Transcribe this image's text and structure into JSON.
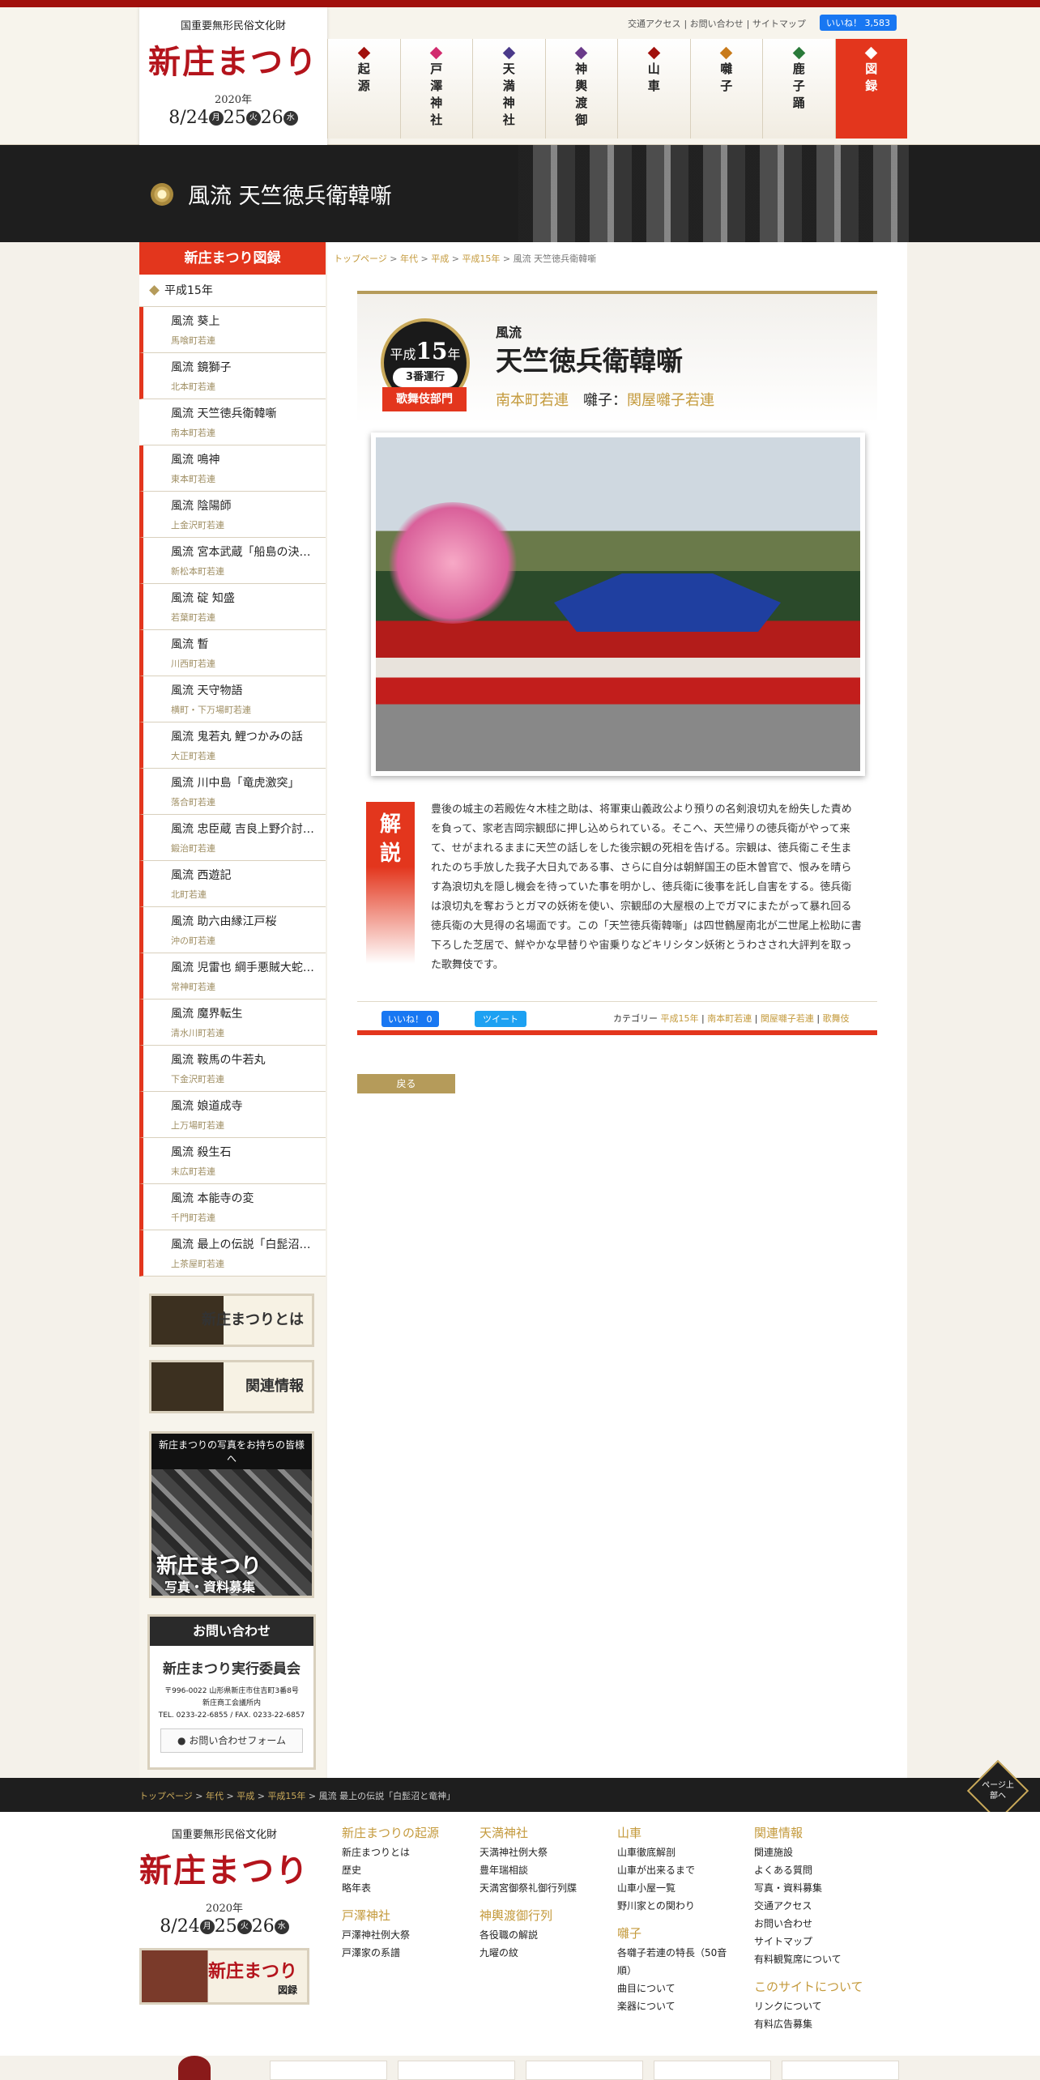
{
  "header": {
    "logo_sub": "国重要無形民俗文化財",
    "logo_main": "新庄まつり",
    "year": "2020年",
    "date_parts": [
      "8/24",
      "月",
      "25",
      "火",
      "26",
      "水"
    ],
    "utility_links": [
      "交通アクセス",
      "お問い合わせ",
      "サイトマップ"
    ],
    "like_label": "いいね！ 3,583"
  },
  "gnav": [
    {
      "label": "起源",
      "color": "#a1100c"
    },
    {
      "label": "戸澤神社",
      "color": "#d12b6e"
    },
    {
      "label": "天満神社",
      "color": "#4a3a8a"
    },
    {
      "label": "神輿渡御",
      "color": "#6a3a8a"
    },
    {
      "label": "山車",
      "color": "#a1100c"
    },
    {
      "label": "囃子",
      "color": "#c87a1a"
    },
    {
      "label": "鹿子踊",
      "color": "#2a7a3a"
    },
    {
      "label": "図録",
      "color": "#ffffff"
    }
  ],
  "band": {
    "title": "風流 天竺徳兵衛韓噺"
  },
  "sidebar": {
    "heading": "新庄まつり図録",
    "year_label": "平成15年",
    "items": [
      {
        "title": "風流 葵上",
        "sub": "馬喰町若連"
      },
      {
        "title": "風流 鏡獅子",
        "sub": "北本町若連"
      },
      {
        "title": "風流 天竺徳兵衛韓噺",
        "sub": "南本町若連"
      },
      {
        "title": "風流 鳴神",
        "sub": "東本町若連"
      },
      {
        "title": "風流 陰陽師",
        "sub": "上金沢町若連"
      },
      {
        "title": "風流 宮本武蔵「船島の決…",
        "sub": "新松本町若連"
      },
      {
        "title": "風流 碇 知盛",
        "sub": "若葉町若連"
      },
      {
        "title": "風流 暫",
        "sub": "川西町若連"
      },
      {
        "title": "風流 天守物語",
        "sub": "横町・下万場町若連"
      },
      {
        "title": "風流 鬼若丸 鯉つかみの話",
        "sub": "大正町若連"
      },
      {
        "title": "風流 川中島「竜虎激突」",
        "sub": "落合町若連"
      },
      {
        "title": "風流 忠臣蔵 吉良上野介討…",
        "sub": "鍛治町若連"
      },
      {
        "title": "風流 西遊記",
        "sub": "北町若連"
      },
      {
        "title": "風流 助六由縁江戸桜",
        "sub": "沖の町若連"
      },
      {
        "title": "風流 児雷也 綱手悪賊大蛇…",
        "sub": "常神町若連"
      },
      {
        "title": "風流 魔界転生",
        "sub": "清水川町若連"
      },
      {
        "title": "風流 鞍馬の牛若丸",
        "sub": "下金沢町若連"
      },
      {
        "title": "風流 娘道成寺",
        "sub": "上万場町若連"
      },
      {
        "title": "風流 殺生石",
        "sub": "末広町若連"
      },
      {
        "title": "風流 本能寺の変",
        "sub": "千門町若連"
      },
      {
        "title": "風流 最上の伝説「白髭沼…",
        "sub": "上茶屋町若連"
      }
    ],
    "banner_about": "新庄まつりとは",
    "banner_related": "関連情報",
    "photo_caption": "新庄まつりの写真をお持ちの皆様へ",
    "photo_title": "新庄まつり",
    "photo_sub": "写真・資料募集",
    "contact": {
      "heading": "お問い合わせ",
      "org": "新庄まつり実行委員会",
      "address": "〒996-0022 山形県新庄市住吉町3番8号",
      "address2": "新庄商工会議所内",
      "tel": "TEL. 0233-22-6855 / FAX. 0233-22-6857",
      "button": "お問い合わせフォーム"
    }
  },
  "breadcrumb": {
    "links": [
      "トップページ",
      "年代",
      "平成",
      "平成15年"
    ],
    "sep": " > ",
    "current": "風流 天竺徳兵衛韓噺"
  },
  "article": {
    "era": "平成",
    "year_num": "15",
    "year_suffix": "年",
    "order": "3番運行",
    "genre": "歌舞伎部門",
    "prefix": "風流",
    "title": "天竺徳兵衛韓噺",
    "group": "南本町若連",
    "hayashi_label": "囃子：",
    "hayashi": "関屋囃子若連",
    "kaisetsu": "解説",
    "description": "豊後の城主の若殿佐々木桂之助は、将軍東山義政公より預りの名剣浪切丸を紛失した責めを負って、家老吉岡宗観邸に押し込められている。そこへ、天竺帰りの徳兵衛がやって来て、せがまれるままに天竺の話しをした後宗観の死相を告げる。宗観は、徳兵衛こそ生まれたのち手放した我子大日丸である事、さらに自分は朝鮮国王の臣木曽官で、恨みを晴らす為浪切丸を隠し機会を待っていた事を明かし、徳兵衛に後事を託し自害をする。徳兵衛は浪切丸を奪おうとガマの妖術を使い、宗観邸の大屋根の上でガマにまたがって暴れ回る徳兵衛の大見得の名場面です。この「天竺徳兵衛韓噺」は四世鶴屋南北が二世尾上松助に書下ろした芝居で、鮮やかな早替りや宙乗りなどキリシタン妖術とうわさされ大評判を取った歌舞伎です。",
    "share_like": "いいね！ 0",
    "share_tweet": "ツイート",
    "category_label": "カテゴリー",
    "categories": [
      "平成15年",
      "南本町若連",
      "関屋囃子若連",
      "歌舞伎"
    ],
    "back": "戻る"
  },
  "footer_crumb": {
    "links": [
      "トップページ",
      "年代",
      "平成",
      "平成15年"
    ],
    "current": "風流 最上の伝説「白髭沼と竜神」"
  },
  "page_top": "ページ上部へ",
  "footer": {
    "banner_title": "新庄まつり",
    "banner_sub": "図録",
    "cols": [
      {
        "groups": [
          {
            "h": "新庄まつりの起源",
            "items": [
              "新庄まつりとは",
              "歴史",
              "略年表"
            ]
          },
          {
            "h": "戸澤神社",
            "items": [
              "戸澤神社例大祭",
              "戸澤家の系譜"
            ]
          }
        ]
      },
      {
        "groups": [
          {
            "h": "天満神社",
            "items": [
              "天満神社例大祭",
              "豊年瑞相談",
              "天満宮御祭礼御行列牒"
            ]
          },
          {
            "h": "神輿渡御行列",
            "items": [
              "各役職の解説",
              "九曜の紋"
            ]
          }
        ]
      },
      {
        "groups": [
          {
            "h": "山車",
            "items": [
              "山車徹底解剖",
              "山車が出来るまで",
              "山車小屋一覧",
              "野川家との関わり"
            ]
          },
          {
            "h": "囃子",
            "items": [
              "各囃子若連の特長（50音",
              "順）",
              "曲目について",
              "楽器について"
            ]
          }
        ]
      },
      {
        "groups": [
          {
            "h": "関連情報",
            "items": [
              "関連施設",
              "よくある質問",
              "写真・資料募集",
              "交通アクセス",
              "お問い合わせ",
              "サイトマップ",
              "有料観覧席について"
            ]
          },
          {
            "h": "このサイトについて",
            "items": [
              "リンクについて",
              "有料広告募集"
            ]
          }
        ]
      }
    ]
  }
}
